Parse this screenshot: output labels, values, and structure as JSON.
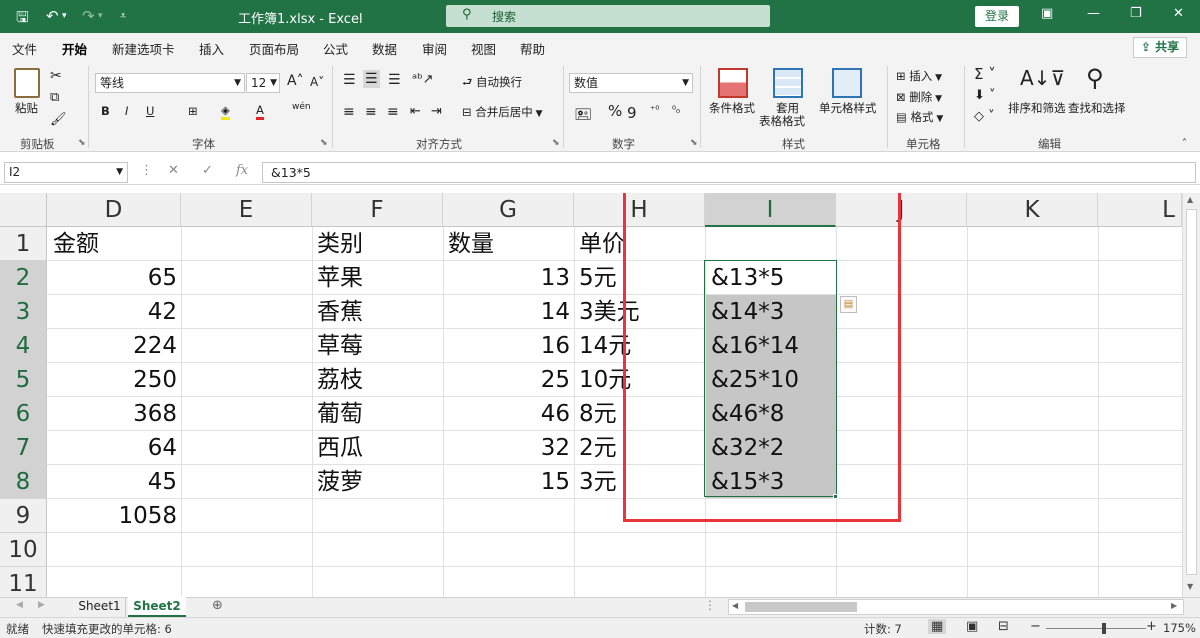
{
  "titlebar": {
    "title": "工作簿1.xlsx  -  Excel",
    "search_placeholder": "搜索",
    "login_label": "登录"
  },
  "tabs": [
    "文件",
    "开始",
    "新建选项卡",
    "插入",
    "页面布局",
    "公式",
    "数据",
    "审阅",
    "视图",
    "帮助"
  ],
  "share_label": "共享",
  "ribbon": {
    "clipboard": {
      "paste": "粘贴",
      "group": "剪贴板"
    },
    "font": {
      "family": "等线",
      "size": "12",
      "group": "字体"
    },
    "alignment": {
      "wrap": "自动换行",
      "merge": "合并后居中",
      "group": "对齐方式"
    },
    "number": {
      "format": "数值",
      "group": "数字"
    },
    "styles": {
      "conditional": "条件格式",
      "table1": "套用",
      "table2": "表格格式",
      "cell_styles": "单元格样式",
      "group": "样式"
    },
    "cells": {
      "insert": "插入",
      "delete": "删除",
      "format": "格式",
      "group": "单元格"
    },
    "editing": {
      "sort": "排序和筛选",
      "find": "查找和选择",
      "group": "编辑"
    }
  },
  "formula_bar": {
    "namebox": "I2",
    "fx": "fx",
    "formula": "&13*5"
  },
  "columns": [
    "D",
    "E",
    "F",
    "G",
    "H",
    "I",
    "J",
    "K",
    "L"
  ],
  "rows": [
    "1",
    "2",
    "3",
    "4",
    "5",
    "6",
    "7",
    "8",
    "9",
    "10",
    "11"
  ],
  "cells": {
    "D": [
      "金额",
      "65",
      "42",
      "224",
      "250",
      "368",
      "64",
      "45",
      "1058"
    ],
    "F": [
      "类别",
      "苹果",
      "香蕉",
      "草莓",
      "荔枝",
      "葡萄",
      "西瓜",
      "菠萝"
    ],
    "G": [
      "数量",
      "13",
      "14",
      "16",
      "25",
      "46",
      "32",
      "15"
    ],
    "H": [
      "单价",
      "5元",
      "3美元",
      "14元",
      "10元",
      "8元",
      "2元",
      "3元"
    ],
    "I": [
      "",
      "&13*5",
      "&14*3",
      "&16*14",
      "&25*10",
      "&46*8",
      "&32*2",
      "&15*3"
    ]
  },
  "sheets": [
    "Sheet1",
    "Sheet2"
  ],
  "status": {
    "ready": "就绪",
    "flash_fill": "快速填充更改的单元格: 6",
    "count": "计数: 7",
    "zoom": "175%"
  },
  "colors": {
    "accent": "#217346",
    "annotation": "#e8353b"
  }
}
